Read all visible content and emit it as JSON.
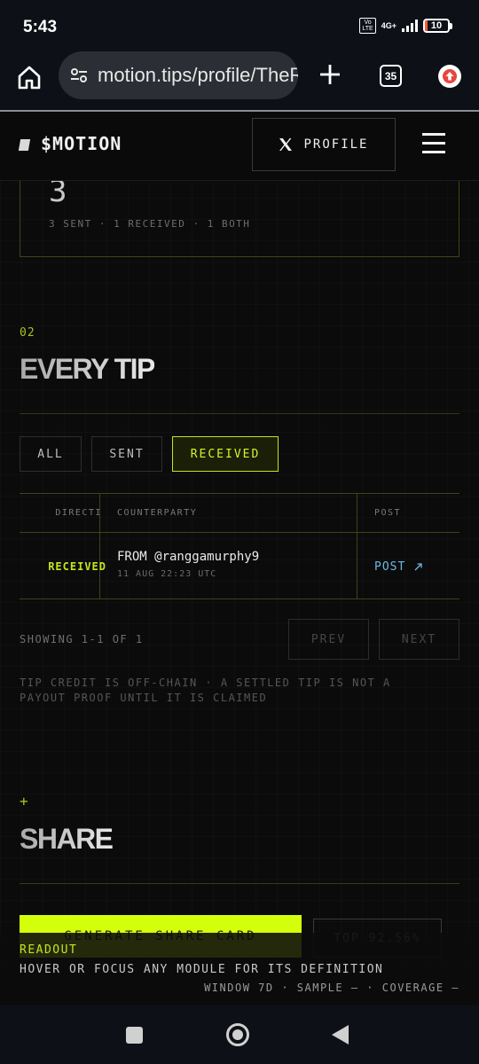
{
  "status_bar": {
    "time": "5:43",
    "volte_label": "Vo\nLTE",
    "network": "4G+",
    "battery_text": "10",
    "battery_level_percent": 10,
    "battery_color": "#ff5a3c"
  },
  "browser": {
    "url": "motion.tips/profile/TheRealMotion",
    "tab_count": "35",
    "icons": [
      "home-icon",
      "site-settings-icon",
      "plus-icon",
      "tab-count-icon",
      "update-icon"
    ]
  },
  "header": {
    "logo": "$MOTION",
    "profile_button": "PROFILE",
    "menu_icon": "hamburger-icon"
  },
  "stats": {
    "value": "3",
    "detail": "3 SENT · 1 RECEIVED · 1 BOTH"
  },
  "tips_section": {
    "number": "02",
    "title": "EVERY TIP",
    "filters": [
      "ALL",
      "SENT",
      "RECEIVED"
    ],
    "active_filter": "RECEIVED",
    "table": {
      "columns": [
        "DIRECTION",
        "COUNTERPARTY",
        "POST"
      ],
      "rows": [
        {
          "direction": "RECEIVED",
          "counterparty": "FROM @ranggamurphy9",
          "time": "11 AUG 22:23 UTC",
          "post": "POST",
          "post_icon": "arrow-up-right-icon"
        }
      ]
    },
    "pagination": {
      "showing": "SHOWING 1-1 OF 1",
      "prev": "PREV",
      "next": "NEXT"
    },
    "disclaimer": "TIP CREDIT IS OFF-CHAIN · A SETTLED TIP IS NOT A PAYOUT PROOF UNTIL IT IS CLAIMED"
  },
  "share_section": {
    "marker": "+",
    "title": "SHARE",
    "generate_button": "GENERATE SHARE CARD",
    "top_badge": "TOP 92.56%"
  },
  "readout": {
    "label": "READOUT",
    "text": "HOVER OR FOCUS ANY MODULE FOR ITS DEFINITION",
    "meta": "WINDOW 7D · SAMPLE — · COVERAGE —"
  },
  "colors": {
    "accent": "#d4ff0a",
    "accent_text": "#c6e31f",
    "link": "#6fb8e0",
    "background": "#0b0b0c"
  }
}
